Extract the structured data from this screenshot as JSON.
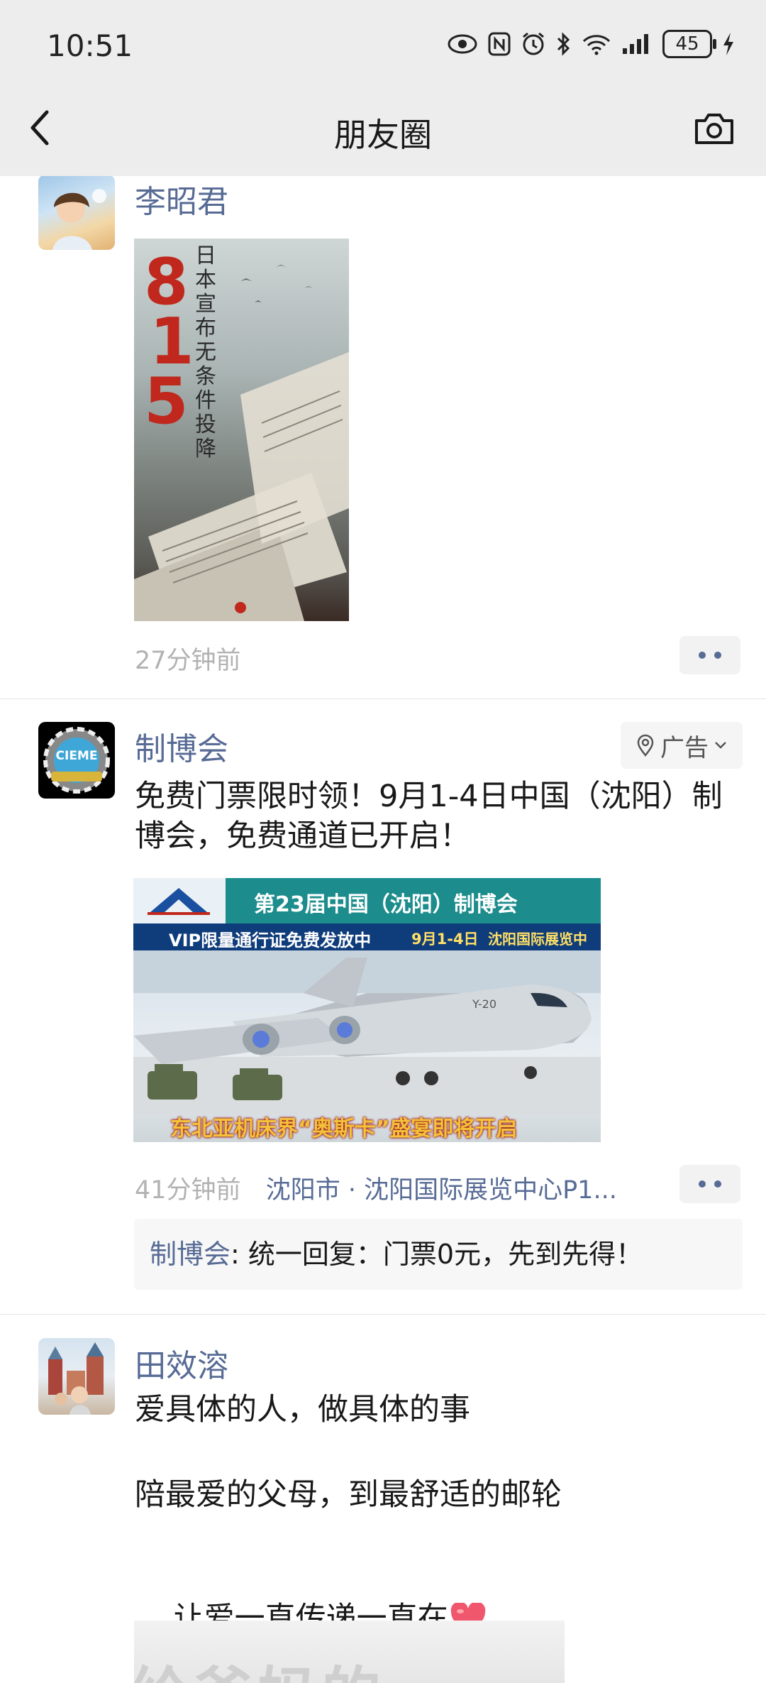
{
  "status_bar": {
    "time": "10:51",
    "battery": "45"
  },
  "header": {
    "title": "朋友圈"
  },
  "posts": [
    {
      "author": "李昭君",
      "image_text": "日本宣布无条件投降",
      "image_number": "815",
      "time": "27分钟前"
    },
    {
      "author": "制博会",
      "ad_label": "广告",
      "text": "免费门票限时领！9月1-4日中国（沈阳）制博会，免费通道已开启！",
      "banner_title": "第23届中国（沈阳）制博会",
      "banner_sub": "VIP限量通行证免费发放中",
      "banner_date": "9月1-4日",
      "banner_venue": "沈阳国际展览中心",
      "banner_bottom": "东北亚机床界“奥斯卡”盛宴即将开启",
      "plane_mark": "Y-20",
      "avatar_text": "CIEME",
      "time": "41分钟前",
      "location": "沈阳市 · 沈阳国际展览中心P1...",
      "comment_author": "制博会",
      "comment_text": ": 统一回复：门票0元，先到先得！"
    },
    {
      "author": "田效溶",
      "line1": "爱具体的人，做具体的事",
      "line2": "陪最爱的父母，到最舒适的邮轮",
      "line3": "让爱一直传递一直在",
      "image_text": "给爸妈的"
    }
  ],
  "colors": {
    "link": "#576b95",
    "header_bg": "#ededed"
  }
}
